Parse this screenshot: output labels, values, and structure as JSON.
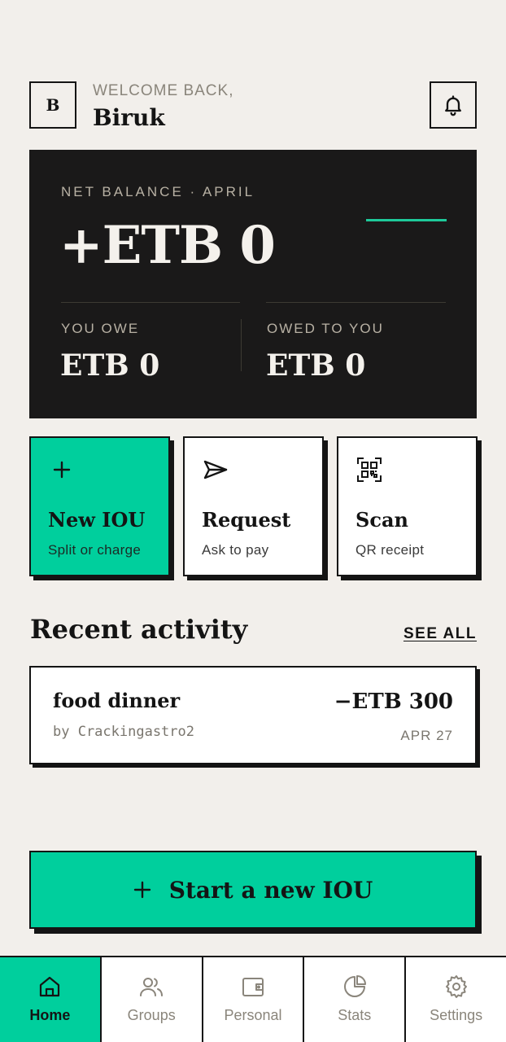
{
  "header": {
    "avatar_initial": "B",
    "welcome": "WELCOME BACK,",
    "username": "Biruk"
  },
  "balance": {
    "label": "NET BALANCE · APRIL",
    "net_amount": "+ETB 0",
    "you_owe_label": "YOU OWE",
    "you_owe_amount": "ETB 0",
    "owed_to_you_label": "OWED TO YOU",
    "owed_to_you_amount": "ETB 0"
  },
  "actions": [
    {
      "icon": "plus-icon",
      "title": "New IOU",
      "subtitle": "Split or charge"
    },
    {
      "icon": "send-icon",
      "title": "Request",
      "subtitle": "Ask to pay"
    },
    {
      "icon": "qr-code-icon",
      "title": "Scan",
      "subtitle": "QR receipt"
    }
  ],
  "recent": {
    "title": "Recent activity",
    "see_all": "SEE ALL",
    "items": [
      {
        "title": "food dinner",
        "by": "by Crackingastro2",
        "amount": "−ETB 300",
        "date": "APR 27"
      }
    ]
  },
  "cta": {
    "label": "Start a new IOU"
  },
  "nav": [
    {
      "icon": "home-icon",
      "label": "Home",
      "active": true
    },
    {
      "icon": "users-icon",
      "label": "Groups",
      "active": false
    },
    {
      "icon": "wallet-icon",
      "label": "Personal",
      "active": false
    },
    {
      "icon": "pie-chart-icon",
      "label": "Stats",
      "active": false
    },
    {
      "icon": "gear-icon",
      "label": "Settings",
      "active": false
    }
  ],
  "colors": {
    "background": "#f2efeb",
    "accent": "#00cf9d",
    "dark_card": "#1a1919",
    "ink": "#141414"
  }
}
